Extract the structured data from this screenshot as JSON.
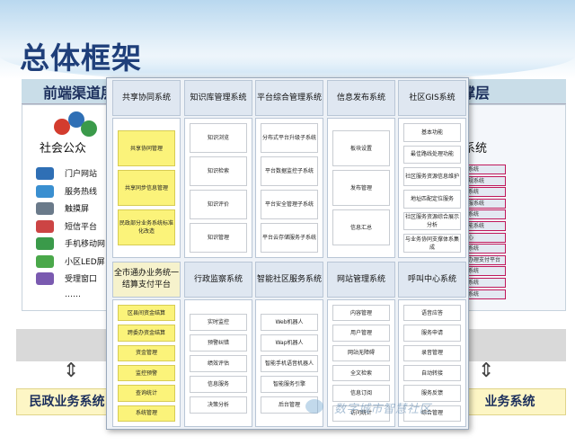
{
  "title": "总体框架",
  "band": {
    "left": "前端渠道层",
    "right": "撑层"
  },
  "left_panel": {
    "heading": "社会公众",
    "channels": [
      "门户网站",
      "服务热线",
      "触摸屏",
      "短信平台",
      "手机移动网",
      "小区LED屏",
      "受理窗口",
      "……"
    ]
  },
  "right_panel": {
    "heading": "系统",
    "items": [
      "系统",
      "规系统",
      "系统",
      "服系统",
      "系统",
      "能系统",
      "心",
      "系统",
      "办理支付平台",
      "系统",
      "系统",
      "系统"
    ]
  },
  "bottom": {
    "left_label": "民政业务系统",
    "right_label": "业务系统"
  },
  "watermark": "数字城市智慧社区",
  "popup": {
    "top_columns": [
      {
        "head": "共享协同系统",
        "yellow": false,
        "items": [
          {
            "t": "共享协同管理",
            "y": true
          },
          {
            "t": "共享同步信息管理",
            "y": true
          },
          {
            "t": "民政部分业务系统标准化改造",
            "y": true
          }
        ]
      },
      {
        "head": "知识库管理系统",
        "yellow": false,
        "items": [
          {
            "t": "知识浏览",
            "y": false
          },
          {
            "t": "知识检索",
            "y": false
          },
          {
            "t": "知识评价",
            "y": false
          },
          {
            "t": "知识管理",
            "y": false
          }
        ]
      },
      {
        "head": "平台综合管理系统",
        "yellow": false,
        "items": [
          {
            "t": "分布式平台升级子系统",
            "y": false
          },
          {
            "t": "平台数据监控子系统",
            "y": false
          },
          {
            "t": "平台安全管理子系统",
            "y": false
          },
          {
            "t": "平台云存储服务子系统",
            "y": false
          }
        ]
      },
      {
        "head": "信息发布系统",
        "yellow": false,
        "items": [
          {
            "t": "板块设置",
            "y": false
          },
          {
            "t": "发布管理",
            "y": false
          },
          {
            "t": "信息汇总",
            "y": false
          }
        ]
      },
      {
        "head": "社区GIS系统",
        "yellow": false,
        "items": [
          {
            "t": "基本功能",
            "y": false
          },
          {
            "t": "最佳路线处理功能",
            "y": false
          },
          {
            "t": "社区服务资源信息维护",
            "y": false
          },
          {
            "t": "地址匹配定位服务",
            "y": false
          },
          {
            "t": "社区服务资源综合展示分析",
            "y": false
          },
          {
            "t": "与业务协同支撑体系集成",
            "y": false
          }
        ]
      }
    ],
    "bottom_columns": [
      {
        "head": "全市通办业务统一结算支付平台",
        "yellow": true,
        "items": [
          {
            "t": "区县间资金结算",
            "y": true
          },
          {
            "t": "跨委办资金结算",
            "y": true
          },
          {
            "t": "资金管理",
            "y": true
          },
          {
            "t": "监控预警",
            "y": true
          },
          {
            "t": "查询统计",
            "y": true
          },
          {
            "t": "系统管理",
            "y": true
          }
        ]
      },
      {
        "head": "行政监察系统",
        "yellow": false,
        "items": [
          {
            "t": "实时监控",
            "y": false
          },
          {
            "t": "预警纠错",
            "y": false
          },
          {
            "t": "绩效评估",
            "y": false
          },
          {
            "t": "信息服务",
            "y": false
          },
          {
            "t": "决策分析",
            "y": false
          }
        ]
      },
      {
        "head": "智能社区服务系统",
        "yellow": false,
        "items": [
          {
            "t": "Web机器人",
            "y": false
          },
          {
            "t": "Wap机器人",
            "y": false
          },
          {
            "t": "智能手机语音机器人",
            "y": false
          },
          {
            "t": "智能服务引擎",
            "y": false
          },
          {
            "t": "后台管理",
            "y": false
          }
        ]
      },
      {
        "head": "网站管理系统",
        "yellow": false,
        "items": [
          {
            "t": "内容管理",
            "y": false
          },
          {
            "t": "用户管理",
            "y": false
          },
          {
            "t": "网站无障碍",
            "y": false
          },
          {
            "t": "全文检索",
            "y": false
          },
          {
            "t": "信息订阅",
            "y": false
          },
          {
            "t": "访问统计",
            "y": false
          }
        ]
      },
      {
        "head": "呼叫中心系统",
        "yellow": false,
        "items": [
          {
            "t": "语音应答",
            "y": false
          },
          {
            "t": "服务申请",
            "y": false
          },
          {
            "t": "录音管理",
            "y": false
          },
          {
            "t": "自动转接",
            "y": false
          },
          {
            "t": "服务反馈",
            "y": false
          },
          {
            "t": "综合管理",
            "y": false
          }
        ]
      }
    ]
  }
}
